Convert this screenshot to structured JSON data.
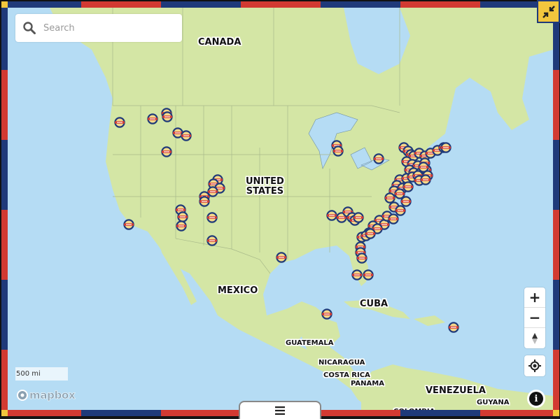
{
  "app": {
    "type": "interactive-map",
    "accent_colors": {
      "blue": "#1f3a7a",
      "red": "#d23a32",
      "yellow": "#f2c63d",
      "water": "#b5dcf4",
      "land": "#d4e6a5"
    }
  },
  "search": {
    "placeholder": "Search",
    "value": "",
    "icon": "search-icon"
  },
  "collapse_button": {
    "icon": "collapse-arrows-icon"
  },
  "controls": {
    "zoom_in": "+",
    "zoom_out": "−",
    "compass_icon": "compass-icon",
    "locate_icon": "locate-icon",
    "info": "i"
  },
  "scale": {
    "label": "500 mi"
  },
  "attribution": {
    "logo_text": "mapbox"
  },
  "menu_tab": {
    "icon": "hamburger-menu-icon"
  },
  "map_labels": {
    "canada": "CANADA",
    "united_states_line1": "UNITED",
    "united_states_line2": "STATES",
    "mexico": "MEXICO",
    "cuba": "CUBA",
    "guatemala": "GUATEMALA",
    "nicaragua": "NICARAGUA",
    "costa_rica": "COSTA RICA",
    "panama": "PANAMA",
    "venezuela": "VENEZUELA",
    "guyana": "GUYANA",
    "colombia": "COLOMBIA"
  },
  "markers": {
    "icon": "location-badge-icon",
    "colors": {
      "ring": "#1f3a7a",
      "fill": "#f5d98a",
      "band": "#d23a32"
    }
  }
}
